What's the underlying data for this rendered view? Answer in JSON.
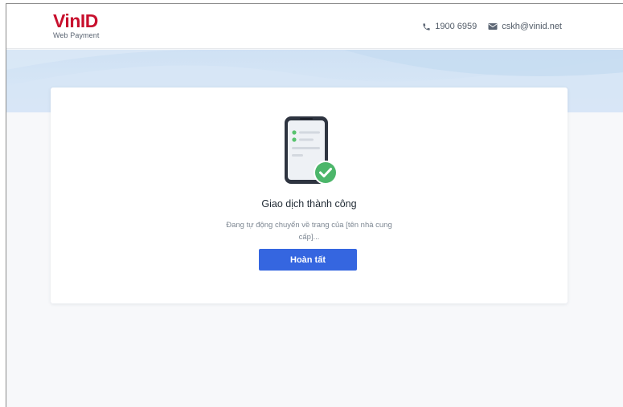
{
  "header": {
    "logo_main": "VinID",
    "logo_sub": "Web Payment",
    "phone_icon": "phone-icon",
    "phone": "1900 6959",
    "email_icon": "mail-icon",
    "email": "cskh@vinid.net"
  },
  "result": {
    "illustration_icon": "phone-success-icon",
    "title": "Giao dịch thành công",
    "message": "Đang tự động chuyển về trang của [tên nhà cung cấp]...",
    "button_label": "Hoàn tất"
  },
  "colors": {
    "brand_red": "#c8102e",
    "primary_button": "#3566e0",
    "success_green": "#4cb66a",
    "band_blue": "#cfe1f4"
  }
}
